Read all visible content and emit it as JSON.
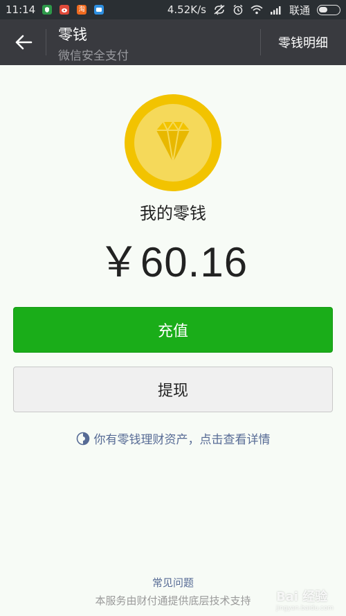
{
  "status_bar": {
    "time": "11:14",
    "net_speed": "4.52K/s",
    "carrier": "联通",
    "notifications": [
      {
        "name": "security-app-icon",
        "color": "#2e9a4a"
      },
      {
        "name": "weibo-app-icon",
        "color": "#e04a3a"
      },
      {
        "name": "taobao-app-icon",
        "color": "#ef6a1f",
        "glyph": "淘"
      },
      {
        "name": "message-app-icon",
        "color": "#2e8fe0"
      }
    ]
  },
  "header": {
    "title": "零钱",
    "subtitle": "微信安全支付",
    "detail_label": "零钱明细"
  },
  "main": {
    "label": "我的零钱",
    "balance": "￥60.16",
    "recharge_label": "充值",
    "withdraw_label": "提现",
    "wealth_link": "你有零钱理财资产，点击查看详情"
  },
  "footer": {
    "faq": "常见问题",
    "service": "本服务由财付通提供底层技术支持"
  },
  "watermark": {
    "brand": "Bai 经验",
    "url": "jingyan.baidu.com"
  },
  "colors": {
    "accent_green": "#1aad19",
    "coin_gold": "#f2c300",
    "link_blue": "#576b95"
  }
}
